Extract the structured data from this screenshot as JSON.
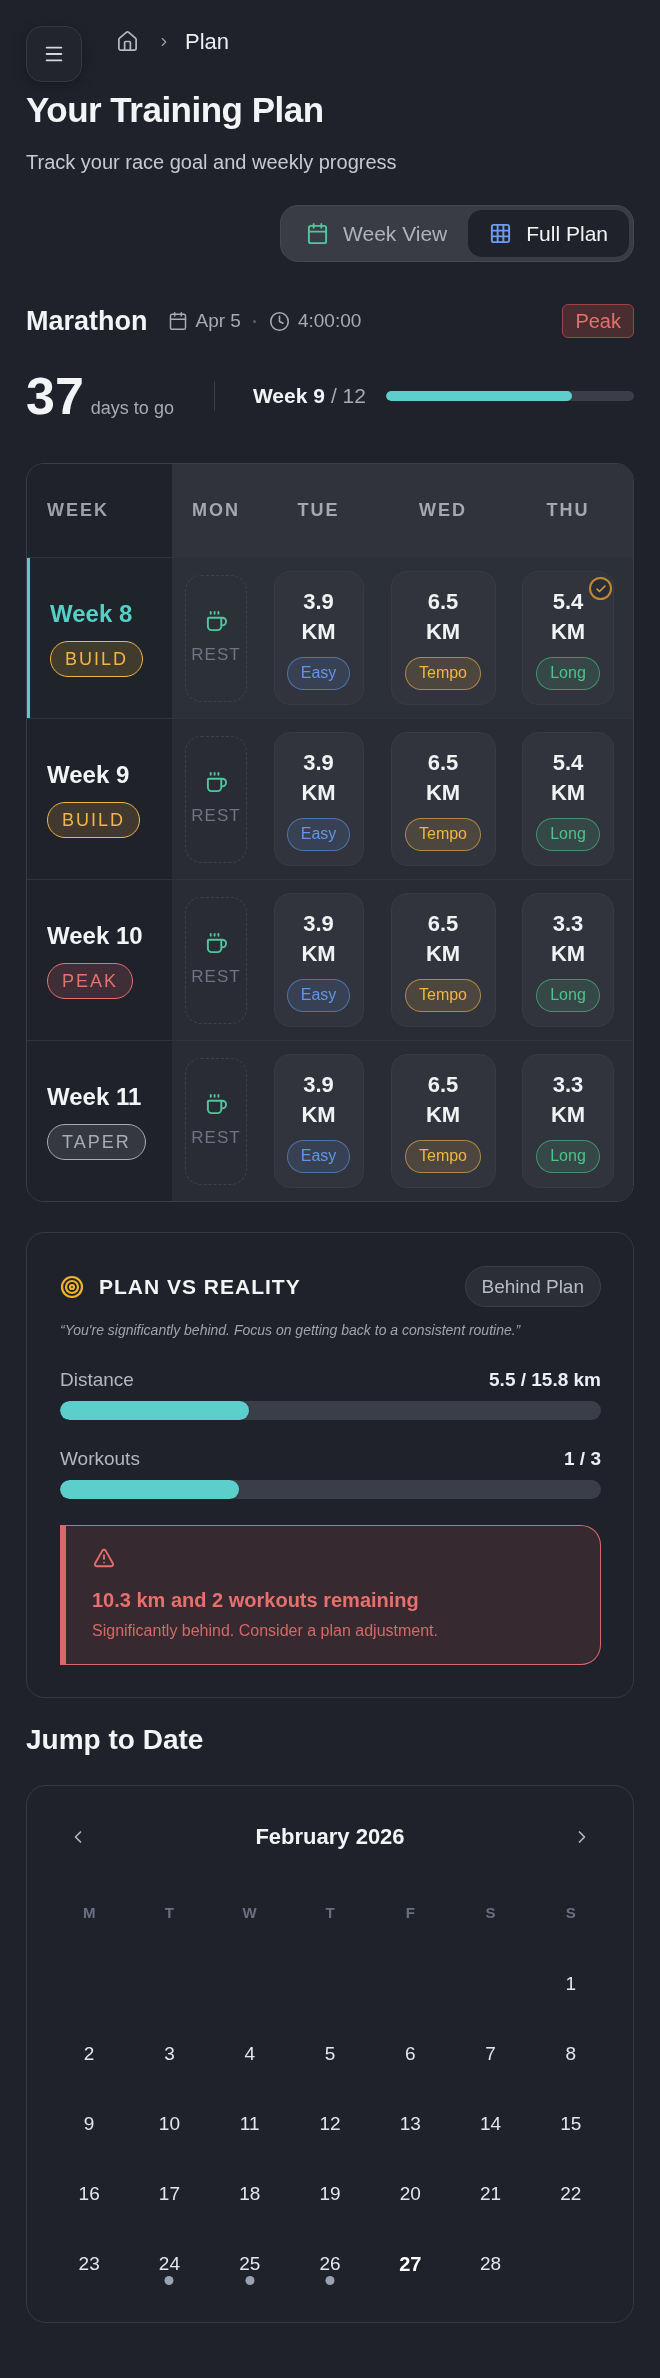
{
  "header": {
    "breadcrumb": [
      "Plan"
    ],
    "title": "Your Training Plan",
    "subtitle": "Track your race goal and weekly progress"
  },
  "view_toggle": [
    {
      "kind": "week",
      "label": "Week View",
      "selected": false
    },
    {
      "kind": "full",
      "label": "Full Plan",
      "selected": true
    }
  ],
  "race": {
    "name": "Marathon",
    "date": "Apr 5",
    "goal_time": "4:00:00",
    "phase": "Peak"
  },
  "countdown": {
    "days": "37",
    "days_label": "days to go",
    "week": "Week 9",
    "week_total": "/ 12",
    "level": 0.75
  },
  "table": {
    "columns": [
      "WEEK",
      "MON",
      "TUE",
      "WED",
      "THU"
    ],
    "rows": [
      {
        "week": "Week 8",
        "selected": true,
        "phase": {
          "label": "BUILD",
          "color": "#f2b544"
        },
        "days": [
          {
            "kind": "rest",
            "label": "REST"
          },
          {
            "kind": "run",
            "value": "3.9",
            "unit": "KM",
            "tag": {
              "label": "Easy",
              "color": "#6395e6"
            },
            "completed": false
          },
          {
            "kind": "run",
            "value": "6.5",
            "unit": "KM",
            "tag": {
              "label": "Tempo",
              "color": "#f2b544"
            },
            "completed": false
          },
          {
            "kind": "run",
            "value": "5.4",
            "unit": "KM",
            "tag": {
              "label": "Long",
              "color": "#4cc38a"
            },
            "completed": true
          }
        ]
      },
      {
        "week": "Week 9",
        "selected": false,
        "phase": {
          "label": "BUILD",
          "color": "#f2b544"
        },
        "days": [
          {
            "kind": "rest",
            "label": "REST"
          },
          {
            "kind": "run",
            "value": "3.9",
            "unit": "KM",
            "tag": {
              "label": "Easy",
              "color": "#6395e6"
            },
            "completed": false
          },
          {
            "kind": "run",
            "value": "6.5",
            "unit": "KM",
            "tag": {
              "label": "Tempo",
              "color": "#f2b544"
            },
            "completed": false
          },
          {
            "kind": "run",
            "value": "5.4",
            "unit": "KM",
            "tag": {
              "label": "Long",
              "color": "#4cc38a"
            },
            "completed": false
          }
        ]
      },
      {
        "week": "Week 10",
        "selected": false,
        "phase": {
          "label": "PEAK",
          "color": "#e8706c"
        },
        "days": [
          {
            "kind": "rest",
            "label": "REST"
          },
          {
            "kind": "run",
            "value": "3.9",
            "unit": "KM",
            "tag": {
              "label": "Easy",
              "color": "#6395e6"
            },
            "completed": false
          },
          {
            "kind": "run",
            "value": "6.5",
            "unit": "KM",
            "tag": {
              "label": "Tempo",
              "color": "#f2b544"
            },
            "completed": false
          },
          {
            "kind": "run",
            "value": "3.3",
            "unit": "KM",
            "tag": {
              "label": "Long",
              "color": "#4cc38a"
            },
            "completed": false
          }
        ]
      },
      {
        "week": "Week 11",
        "selected": false,
        "phase": {
          "label": "TAPER",
          "color": "#a7acb6"
        },
        "days": [
          {
            "kind": "rest",
            "label": "REST"
          },
          {
            "kind": "run",
            "value": "3.9",
            "unit": "KM",
            "tag": {
              "label": "Easy",
              "color": "#6395e6"
            },
            "completed": false
          },
          {
            "kind": "run",
            "value": "6.5",
            "unit": "KM",
            "tag": {
              "label": "Tempo",
              "color": "#f2b544"
            },
            "completed": false
          },
          {
            "kind": "run",
            "value": "3.3",
            "unit": "KM",
            "tag": {
              "label": "Long",
              "color": "#4cc38a"
            },
            "completed": false
          }
        ]
      }
    ]
  },
  "plan_vs_reality": {
    "title": "PLAN VS REALITY",
    "status": "Behind Plan",
    "quote": "“You're significantly behind. Focus on getting back to a consistent routine.”",
    "metrics": [
      {
        "label": "Distance",
        "value": "5.5 / 15.8 km",
        "level": 0.35
      },
      {
        "label": "Workouts",
        "value": "1 / 3",
        "level": 0.33
      }
    ],
    "alert": {
      "title": "10.3 km and 2 workouts remaining",
      "message": "Significantly behind. Consider a plan adjustment."
    }
  },
  "calendar": {
    "title": "Jump to Date",
    "month": "February 2026",
    "weekdays": [
      "M",
      "T",
      "W",
      "T",
      "F",
      "S",
      "S"
    ],
    "weeks": [
      [
        {
          "label": "1",
          "has_workout": false,
          "today": false
        }
      ],
      [
        {
          "label": "2",
          "has_workout": false,
          "today": false
        },
        {
          "label": "3",
          "has_workout": false,
          "today": false
        },
        {
          "label": "4",
          "has_workout": false,
          "today": false
        },
        {
          "label": "5",
          "has_workout": false,
          "today": false
        },
        {
          "label": "6",
          "has_workout": false,
          "today": false
        },
        {
          "label": "7",
          "has_workout": false,
          "today": false
        },
        {
          "label": "8",
          "has_workout": false,
          "today": false
        }
      ],
      [
        {
          "label": "9",
          "has_workout": false,
          "today": false
        },
        {
          "label": "10",
          "has_workout": false,
          "today": false
        },
        {
          "label": "11",
          "has_workout": false,
          "today": false
        },
        {
          "label": "12",
          "has_workout": false,
          "today": false
        },
        {
          "label": "13",
          "has_workout": false,
          "today": false
        },
        {
          "label": "14",
          "has_workout": false,
          "today": false
        },
        {
          "label": "15",
          "has_workout": false,
          "today": false
        }
      ],
      [
        {
          "label": "16",
          "has_workout": false,
          "today": false
        },
        {
          "label": "17",
          "has_workout": false,
          "today": false
        },
        {
          "label": "18",
          "has_workout": false,
          "today": false
        },
        {
          "label": "19",
          "has_workout": false,
          "today": false
        },
        {
          "label": "20",
          "has_workout": false,
          "today": false
        },
        {
          "label": "21",
          "has_workout": false,
          "today": false
        },
        {
          "label": "22",
          "has_workout": false,
          "today": false
        }
      ],
      [
        {
          "label": "23",
          "has_workout": false,
          "today": false
        },
        {
          "label": "24",
          "has_workout": true,
          "today": false
        },
        {
          "label": "25",
          "has_workout": true,
          "today": false
        },
        {
          "label": "26",
          "has_workout": true,
          "today": false
        },
        {
          "label": "27",
          "has_workout": false,
          "today": true
        },
        {
          "label": "28",
          "has_workout": false,
          "today": false
        }
      ]
    ]
  }
}
